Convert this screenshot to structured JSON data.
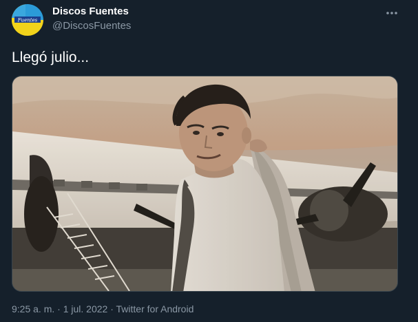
{
  "author": {
    "display_name": "Discos Fuentes",
    "handle": "@DiscosFuentes",
    "avatar_icon": "discos-fuentes-logo",
    "avatar_logo_text": "Fuentes"
  },
  "menu": {
    "icon": "more-horizontal-icon"
  },
  "tweet": {
    "text": "Llegó julio...",
    "media_description": "sepia photo"
  },
  "meta": {
    "time": "9:25 a. m.",
    "separator_1": " · ",
    "date": "1 jul. 2022",
    "separator_2": " · ",
    "source": "Twitter for Android"
  },
  "colors": {
    "background": "#15202b",
    "text_primary": "#ffffff",
    "text_secondary": "#8b98a5",
    "border": "#38444d"
  }
}
